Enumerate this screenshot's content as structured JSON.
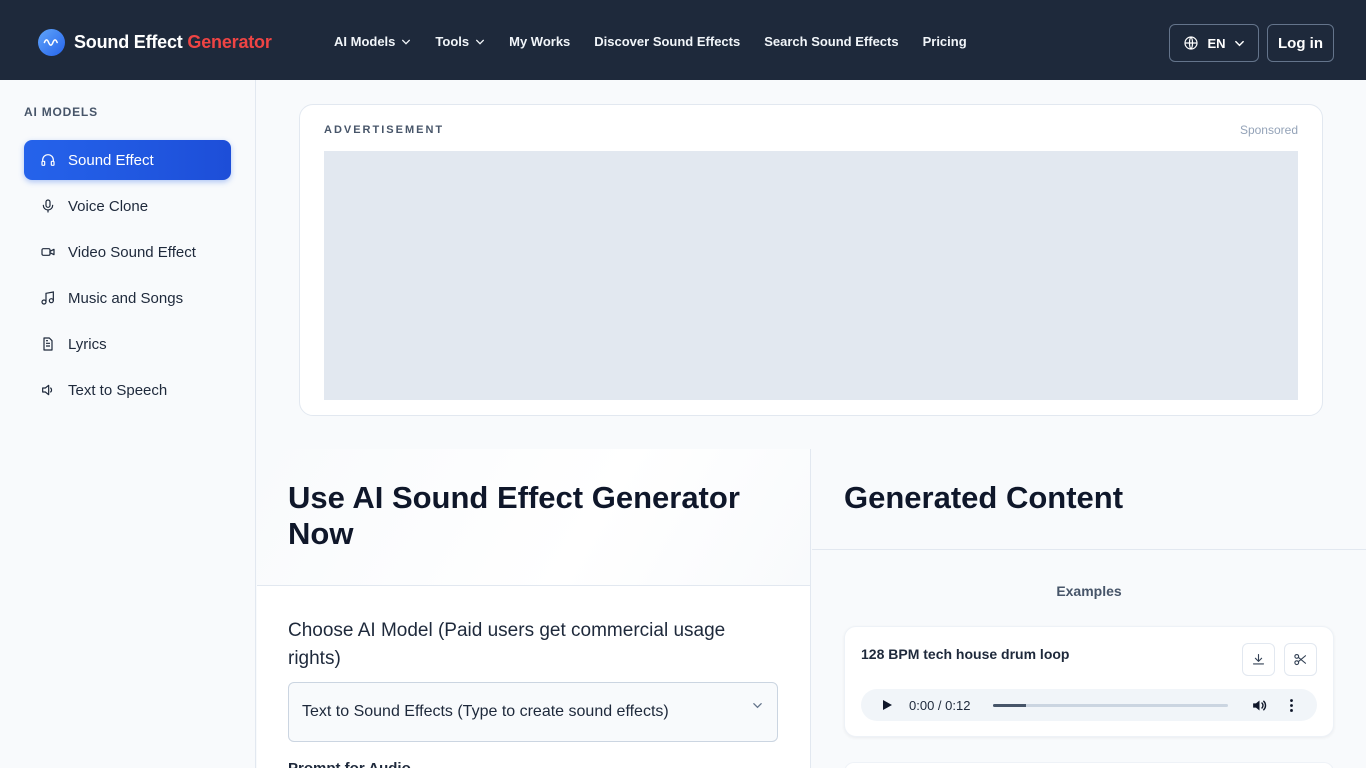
{
  "header": {
    "logo_text": "Sound Effect",
    "logo_accent": "Generator",
    "nav": [
      {
        "label": "AI Models",
        "has_dropdown": true
      },
      {
        "label": "Tools",
        "has_dropdown": true
      },
      {
        "label": "My Works",
        "has_dropdown": false
      },
      {
        "label": "Discover Sound Effects",
        "has_dropdown": false
      },
      {
        "label": "Search Sound Effects",
        "has_dropdown": false
      },
      {
        "label": "Pricing",
        "has_dropdown": false
      }
    ],
    "language": "EN",
    "login_label": "Log in"
  },
  "sidebar": {
    "heading": "AI MODELS",
    "items": [
      {
        "label": "Sound Effect",
        "icon": "headphones-icon",
        "active": true
      },
      {
        "label": "Voice Clone",
        "icon": "microphone-icon",
        "active": false
      },
      {
        "label": "Video Sound Effect",
        "icon": "video-camera-icon",
        "active": false
      },
      {
        "label": "Music and Songs",
        "icon": "music-note-icon",
        "active": false
      },
      {
        "label": "Lyrics",
        "icon": "document-icon",
        "active": false
      },
      {
        "label": "Text to Speech",
        "icon": "speaker-icon",
        "active": false
      }
    ]
  },
  "ad": {
    "label": "ADVERTISEMENT",
    "sponsored": "Sponsored"
  },
  "generator": {
    "title": "Use AI Sound Effect Generator Now",
    "model_label": "Choose AI Model (Paid users get commercial usage rights)",
    "model_selected": "Text to Sound Effects (Type to create sound effects)",
    "next_label": "Prompt for Audio"
  },
  "output": {
    "title": "Generated Content",
    "examples_label": "Examples",
    "examples": [
      {
        "title": "128 BPM tech house drum loop",
        "current_time": "0:00",
        "duration": "0:12",
        "time_display": "0:00 / 0:12",
        "progress_fraction": 0.14
      }
    ]
  },
  "colors": {
    "header_bg": "#1e293b",
    "accent": "#2563eb",
    "brand_red": "#ef4444"
  }
}
